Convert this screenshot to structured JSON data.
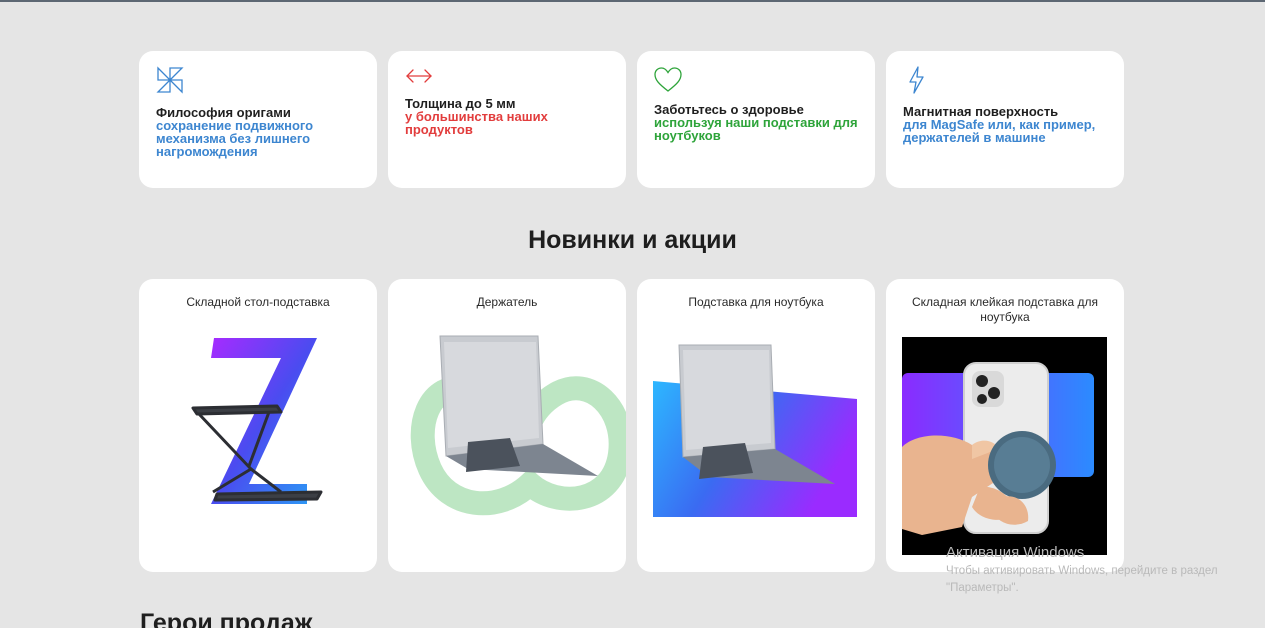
{
  "features": [
    {
      "icon": "pinwheel-icon",
      "title": "Философия оригами",
      "desc": "сохранение подвижного механизма без лишнего нагромождения",
      "color": "#3d86d0"
    },
    {
      "icon": "arrows-horizontal-icon",
      "title": "Толщина до 5 мм",
      "desc": "у большинства наших продуктов",
      "color": "#e23d3d"
    },
    {
      "icon": "heart-icon",
      "title": "Заботьтесь о здоровье",
      "desc": "используя наши подставки для ноутбуков",
      "color": "#2ea43a"
    },
    {
      "icon": "lightning-icon",
      "title": "Магнитная поверхность",
      "desc": "для MagSafe или, как пример, держателей в машине",
      "color": "#3d86d0"
    }
  ],
  "section_title": "Новинки и акции",
  "products": [
    {
      "name": "Складной стол-подставка"
    },
    {
      "name": "Держатель"
    },
    {
      "name": "Подставка для ноутбука"
    },
    {
      "name": "Складная клейкая подставка для ноутбука"
    }
  ],
  "bottom_title": "Герои продаж",
  "watermark": {
    "title": "Активация Windows",
    "text": "Чтобы активировать Windows, перейдите в раздел \"Параметры\"."
  }
}
